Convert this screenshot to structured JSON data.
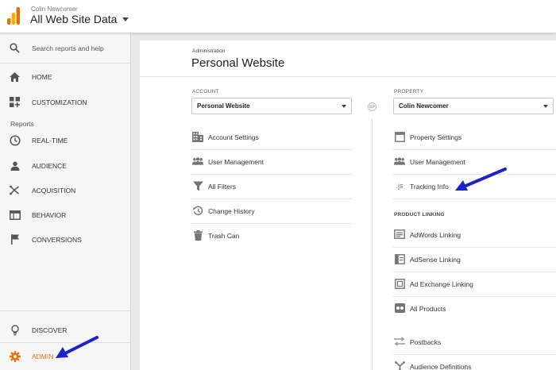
{
  "header": {
    "account_name": "Colin Newcomer",
    "property_view": "All Web Site Data"
  },
  "sidebar": {
    "search_label": "Search reports and help",
    "home_label": "HOME",
    "customization_label": "CUSTOMIZATION",
    "reports_heading": "Reports",
    "realtime_label": "REAL-TIME",
    "audience_label": "AUDIENCE",
    "acquisition_label": "ACQUISITION",
    "behavior_label": "BEHAVIOR",
    "conversions_label": "CONVERSIONS",
    "discover_label": "DISCOVER",
    "admin_label": "ADMIN"
  },
  "main": {
    "breadcrumb": "Administration",
    "title": "Personal Website",
    "account": {
      "heading": "ACCOUNT",
      "selected": "Personal Website",
      "items": [
        "Account Settings",
        "User Management",
        "All Filters",
        "Change History",
        "Trash Can"
      ]
    },
    "property": {
      "heading": "PROPERTY",
      "selected": "Colin Newcomer",
      "items": [
        "Property Settings",
        "User Management",
        "Tracking Info"
      ],
      "product_linking_heading": "PRODUCT LINKING",
      "linking_items": [
        "AdWords Linking",
        "AdSense Linking",
        "Ad Exchange Linking",
        "All Products"
      ],
      "more_items": [
        "Postbacks",
        "Audience Definitions"
      ]
    }
  },
  "colors": {
    "accent_orange": "#e8710a",
    "annotation_arrow": "#1a24c8"
  }
}
